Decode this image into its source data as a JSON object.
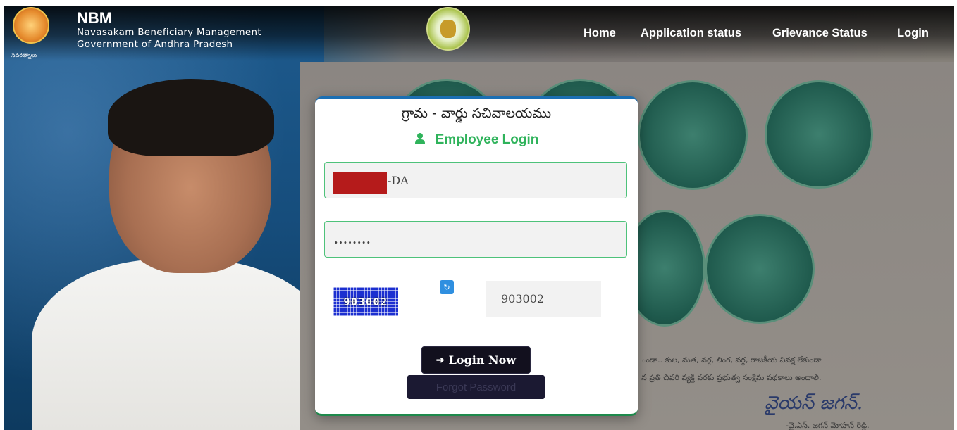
{
  "header": {
    "brand_title": "NBM",
    "brand_line1": "Navasakam Beneficiary Management",
    "brand_line2": "Government of Andhra Pradesh",
    "logo_caption": "నవరత్నాలు"
  },
  "nav": {
    "home": "Home",
    "application_status": "Application status",
    "grievance_status": "Grievance Status",
    "login": "Login"
  },
  "login_card": {
    "title": "గ్రామ - వార్డు సచివాలయము",
    "subtitle": "Employee Login",
    "username_suffix": "-DA",
    "password_value": "........",
    "captcha_image_text": "903002",
    "captcha_input_value": "903002",
    "login_button": "Login Now",
    "forgot_button": "Forgot Password"
  },
  "background": {
    "quote_line1": "ండా.. కుల, మత, వర్గ, లింగ, వర్గ, రాజకీయ వివక్ష లేకుండా",
    "quote_line2": "న ప్రతి చివరి వ్యక్తి వరకు ప్రభుత్వ సంక్షేమ పథకాలు అందాలి.",
    "signature": "వైయస్ జగన్.",
    "signature_name": "-వై.ఎస్. జగన్ మోహన్ రెడ్డి."
  },
  "colors": {
    "accent_green": "#2fb35b",
    "card_border_top": "#1b6fb3",
    "button_dark": "#12101e",
    "captcha_blue": "#1c2fd0",
    "redaction": "#b51b1b"
  },
  "icons": {
    "user": "user-icon",
    "refresh": "refresh-icon",
    "login": "sign-in-icon"
  }
}
